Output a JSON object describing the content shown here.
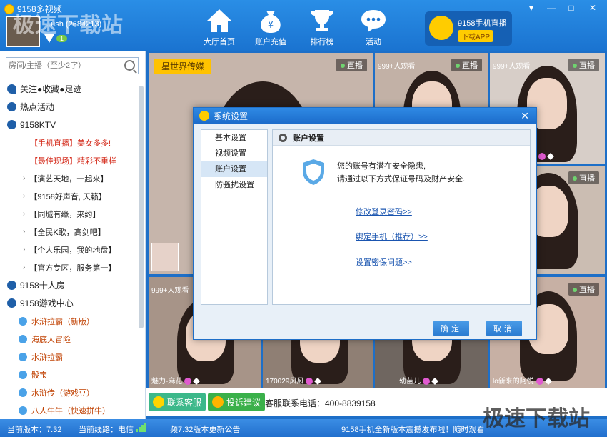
{
  "header": {
    "app_title": "9158多视频",
    "user_name": "...ush (2684213)",
    "vip_level": "1",
    "watermark": "极速下载站",
    "nav": [
      {
        "label": "大厅首页",
        "icon": "home-icon"
      },
      {
        "label": "账户充值",
        "icon": "money-bag-icon"
      },
      {
        "label": "排行榜",
        "icon": "trophy-icon"
      },
      {
        "label": "活动",
        "icon": "chat-bubble-icon"
      }
    ],
    "app_promo": {
      "title": "9158手机直播",
      "button": "下载APP"
    },
    "window_controls": [
      "▾",
      "—",
      "□",
      "✕"
    ]
  },
  "sidebar": {
    "search_placeholder": "房间/主播（至少2字）",
    "items": [
      {
        "label": "关注●收藏●足迹",
        "type": "head",
        "icon": "heart-icon"
      },
      {
        "label": "热点活动",
        "type": "head",
        "icon": "hot-icon"
      },
      {
        "label": "9158KTV",
        "type": "head",
        "icon": "mic-icon"
      },
      {
        "label": "【手机直播】美女多多!",
        "type": "sub",
        "red": true
      },
      {
        "label": "【最佳现场】精彩不重样",
        "type": "sub",
        "red": true
      },
      {
        "label": "【演艺天地，一起来】",
        "type": "sub2"
      },
      {
        "label": "【9158好声音, 天籁】",
        "type": "sub2"
      },
      {
        "label": "【同城有缘，来约】",
        "type": "sub2"
      },
      {
        "label": "【全民K歌，高剑吧】",
        "type": "sub2"
      },
      {
        "label": "【个人乐园，我的地盘】",
        "type": "sub2"
      },
      {
        "label": "【官方专区，服务第一】",
        "type": "sub2"
      },
      {
        "label": "9158十人房",
        "type": "head",
        "icon": "house-icon"
      },
      {
        "label": "9158游戏中心",
        "type": "head",
        "icon": "gamepad-icon"
      },
      {
        "label": "水浒拉霸（新版）",
        "type": "game"
      },
      {
        "label": "海底大冒险",
        "type": "game"
      },
      {
        "label": "水浒拉霸",
        "type": "game"
      },
      {
        "label": "骰宝",
        "type": "game"
      },
      {
        "label": "水浒传（游戏豆）",
        "type": "game"
      },
      {
        "label": "八人牛牛（快速拼牛）",
        "type": "game"
      }
    ]
  },
  "content": {
    "banner_tag": "星世界传媒",
    "live_label": "直播",
    "viewers": "999+人观看",
    "tiles": [
      {
        "name": "",
        "viewers": ""
      },
      {
        "name": "",
        "viewers": "999+人观看"
      },
      {
        "name": "",
        "viewers": "999+人观看"
      },
      {
        "name": "",
        "viewers": ""
      },
      {
        "name": "魅力-麻花",
        "viewers": "999+人观看"
      },
      {
        "name": "170029风风",
        "viewers": ""
      },
      {
        "name": "幼苗儿",
        "viewers": ""
      },
      {
        "name": "lo新来的阿悦",
        "viewers": ""
      }
    ],
    "contact_button": "联系客服",
    "complaint_button": "投诉建议",
    "service_phone": "客服联系电话：400-8839158"
  },
  "statusbar": {
    "version": "当前版本：7.32",
    "line": "当前线路：电信",
    "update_notice": "频7.32版本更新公告",
    "marquee": "9158手机全新版本震撼发布啦！随时观看",
    "watermark": "极速下载站"
  },
  "dialog": {
    "title": "系统设置",
    "close": "✕",
    "menu": [
      "基本设置",
      "视频设置",
      "账户设置",
      "防骚扰设置"
    ],
    "active_index": 2,
    "section_title": "账户设置",
    "warning_line1": "您的账号有潜在安全隐患,",
    "warning_line2": "请通过以下方式保证号码及财产安全.",
    "links": [
      "修改登录密码>>",
      "绑定手机（推荐）>>",
      "设置密保问题>>"
    ],
    "ok": "确定",
    "cancel": "取消"
  }
}
